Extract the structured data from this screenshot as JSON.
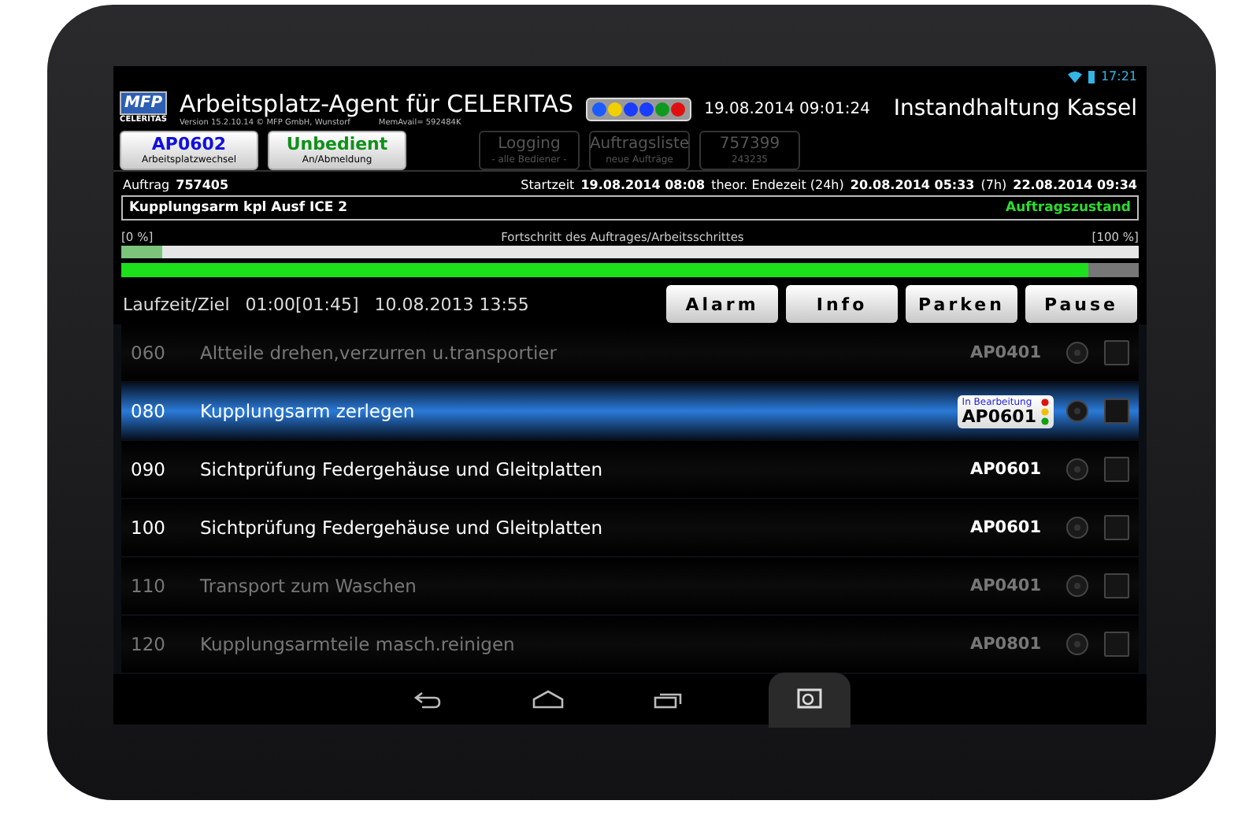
{
  "status_bar": {
    "time": "17:21"
  },
  "header": {
    "logo_top": "MFP",
    "logo_bottom": "CELERITAS",
    "title": "Arbeitsplatz-Agent für CELERITAS",
    "version": "Version 15.2.10.14 © MFP GmbH, Wunstorf",
    "memory": "MemAvail= 592484K",
    "lights": [
      {
        "color": "#1a5cff"
      },
      {
        "color": "#f2d000"
      },
      {
        "color": "#1a3cff"
      },
      {
        "color": "#1a3cff"
      },
      {
        "color": "#0e9a1e"
      },
      {
        "color": "#e01010"
      }
    ],
    "datetime": "19.08.2014 09:01:24",
    "location": "Instandhaltung Kassel"
  },
  "buttons": [
    {
      "title": "AP0602",
      "subtitle": "Arbeitsplatzwechsel",
      "color": "#1010e0",
      "disabled": false
    },
    {
      "title": "Unbedient",
      "subtitle": "An/Abmeldung",
      "color": "#10901a",
      "disabled": false
    },
    {
      "title": "Logging",
      "subtitle": "- alle Bediener -",
      "disabled": true
    },
    {
      "title": "Auftragsliste",
      "subtitle": "neue Aufträge",
      "disabled": true
    },
    {
      "title": "757399",
      "subtitle": "243235",
      "disabled": true
    }
  ],
  "order": {
    "label": "Auftrag",
    "number": "757405",
    "start_label": "Startzeit",
    "start": "19.08.2014 08:08",
    "end_label": "theor. Endezeit (24h)",
    "end": "20.08.2014 05:33",
    "dur_label": "(7h)",
    "due": "22.08.2014 09:34"
  },
  "article": {
    "name": "Kupplungsarm kpl Ausf ICE 2",
    "state": "Auftragszustand"
  },
  "progress": {
    "min_label": "[0 %]",
    "caption": "Fortschritt des Auftrages/Arbeitsschrittes",
    "max_label": "[100 %]",
    "bars": [
      {
        "level": 0.04
      },
      {
        "level": 0.95
      }
    ]
  },
  "runtime": {
    "label": "Laufzeit/Ziel",
    "value": "01:00[01:45]",
    "date": "10.08.2013 13:55"
  },
  "actions": [
    "Alarm",
    "Info",
    "Parken",
    "Pause"
  ],
  "steps": [
    {
      "number": "060",
      "name": "Altteile drehen,verzurren u.transportier",
      "workplace": "AP0401",
      "active": false,
      "selected": false,
      "checked": false
    },
    {
      "number": "080",
      "name": "Kupplungsarm zerlegen",
      "workplace": "AP0601",
      "active": true,
      "selected": true,
      "checked": false,
      "status": "In Bearbeitung"
    },
    {
      "number": "090",
      "name": "Sichtprüfung Federgehäuse und Gleitplatten",
      "workplace": "AP0601",
      "active": true,
      "selected": false,
      "checked": false
    },
    {
      "number": "100",
      "name": "Sichtprüfung Federgehäuse und Gleitplatten",
      "workplace": "AP0601",
      "active": true,
      "selected": false,
      "checked": false
    },
    {
      "number": "110",
      "name": "Transport zum Waschen",
      "workplace": "AP0401",
      "active": false,
      "selected": false,
      "checked": false
    },
    {
      "number": "120",
      "name": "Kupplungsarmteile masch.reinigen",
      "workplace": "AP0801",
      "active": false,
      "selected": false,
      "checked": false
    }
  ]
}
